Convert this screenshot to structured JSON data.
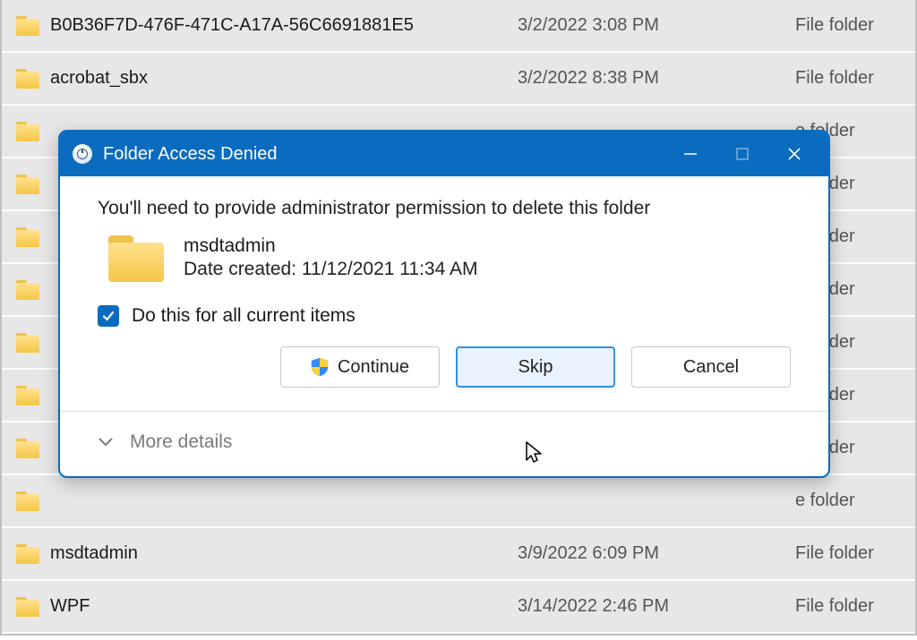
{
  "files": [
    {
      "name": "B0B36F7D-476F-471C-A17A-56C6691881E5",
      "date": "3/2/2022 3:08 PM",
      "type": "File folder"
    },
    {
      "name": "acrobat_sbx",
      "date": "3/2/2022 8:38 PM",
      "type": "File folder"
    },
    {
      "name": "",
      "date": "",
      "type": "e folder"
    },
    {
      "name": "",
      "date": "",
      "type": "e folder"
    },
    {
      "name": "",
      "date": "",
      "type": "e folder"
    },
    {
      "name": "",
      "date": "",
      "type": "e folder"
    },
    {
      "name": "",
      "date": "",
      "type": "e folder"
    },
    {
      "name": "",
      "date": "",
      "type": "e folder"
    },
    {
      "name": "",
      "date": "",
      "type": "e folder"
    },
    {
      "name": "",
      "date": "",
      "type": "e folder"
    },
    {
      "name": "msdtadmin",
      "date": "3/9/2022 6:09 PM",
      "type": "File folder"
    },
    {
      "name": "WPF",
      "date": "3/14/2022 2:46 PM",
      "type": "File folder"
    }
  ],
  "dialog": {
    "title": "Folder Access Denied",
    "message": "You'll need to provide administrator permission to delete this folder",
    "target_name": "msdtadmin",
    "target_meta": "Date created: 11/12/2021 11:34 AM",
    "do_all_label": "Do this for all current items",
    "do_all_checked": true,
    "buttons": {
      "continue": "Continue",
      "skip": "Skip",
      "cancel": "Cancel"
    },
    "more_details": "More details"
  }
}
